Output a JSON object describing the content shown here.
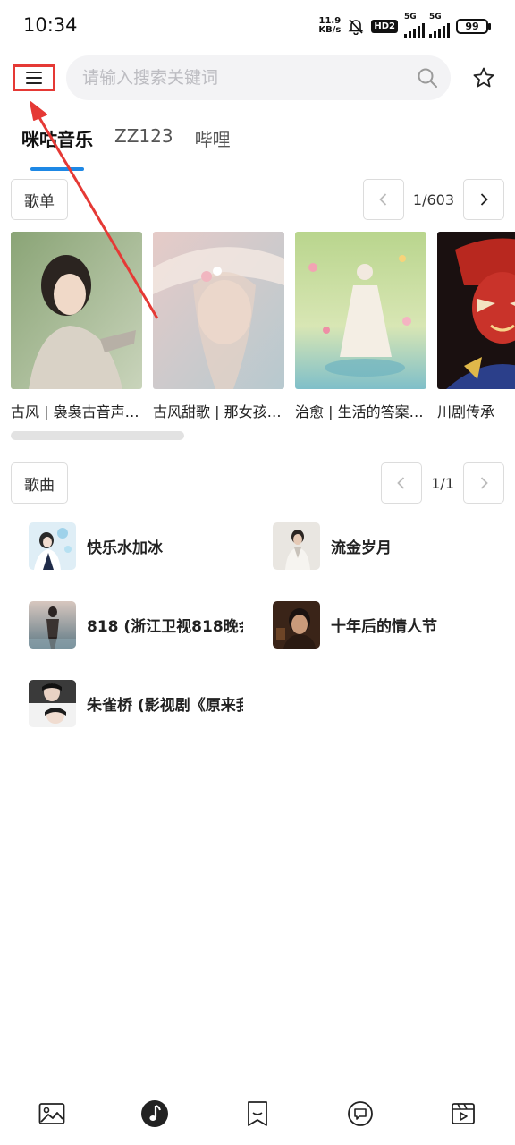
{
  "status_bar": {
    "time": "10:34",
    "net_speed_value": "11.9",
    "net_speed_unit": "KB/s",
    "hd": "HD2",
    "sim1": "5G",
    "sim2": "5G",
    "battery": "99"
  },
  "header": {
    "menu_icon": "hamburger-menu-icon",
    "search_placeholder": "请输入搜索关键词",
    "search_icon": "search-icon",
    "favorite_icon": "star-icon"
  },
  "tabs": [
    {
      "label": "咪咕音乐",
      "active": true
    },
    {
      "label": "ZZ123",
      "active": false
    },
    {
      "label": "哔哩",
      "active": false
    }
  ],
  "playlists_section": {
    "label": "歌单",
    "page": "1/603",
    "prev_enabled": false,
    "next_enabled": true,
    "items": [
      {
        "title": "古风 | 袅袅古音声声入梦"
      },
      {
        "title": "古风甜歌 | 那女孩的心动"
      },
      {
        "title": "治愈 | 生活的答案就在风里"
      },
      {
        "title": "川剧传承"
      }
    ]
  },
  "songs_section": {
    "label": "歌曲",
    "page": "1/1",
    "prev_enabled": false,
    "next_enabled": false,
    "items": [
      {
        "title": "快乐水加冰"
      },
      {
        "title": "流金岁月"
      },
      {
        "title": "818 (浙江卫视818晚会"
      },
      {
        "title": "十年后的情人节"
      },
      {
        "title": "朱雀桥 (影视剧《原来我"
      }
    ]
  },
  "bottom_nav": [
    {
      "icon": "image-icon"
    },
    {
      "icon": "music-note-icon",
      "active": true
    },
    {
      "icon": "bookmark-icon"
    },
    {
      "icon": "chat-bubble-icon"
    },
    {
      "icon": "video-clip-icon"
    }
  ],
  "colors": {
    "accent": "#1e88e5",
    "annotation": "#e53935"
  }
}
